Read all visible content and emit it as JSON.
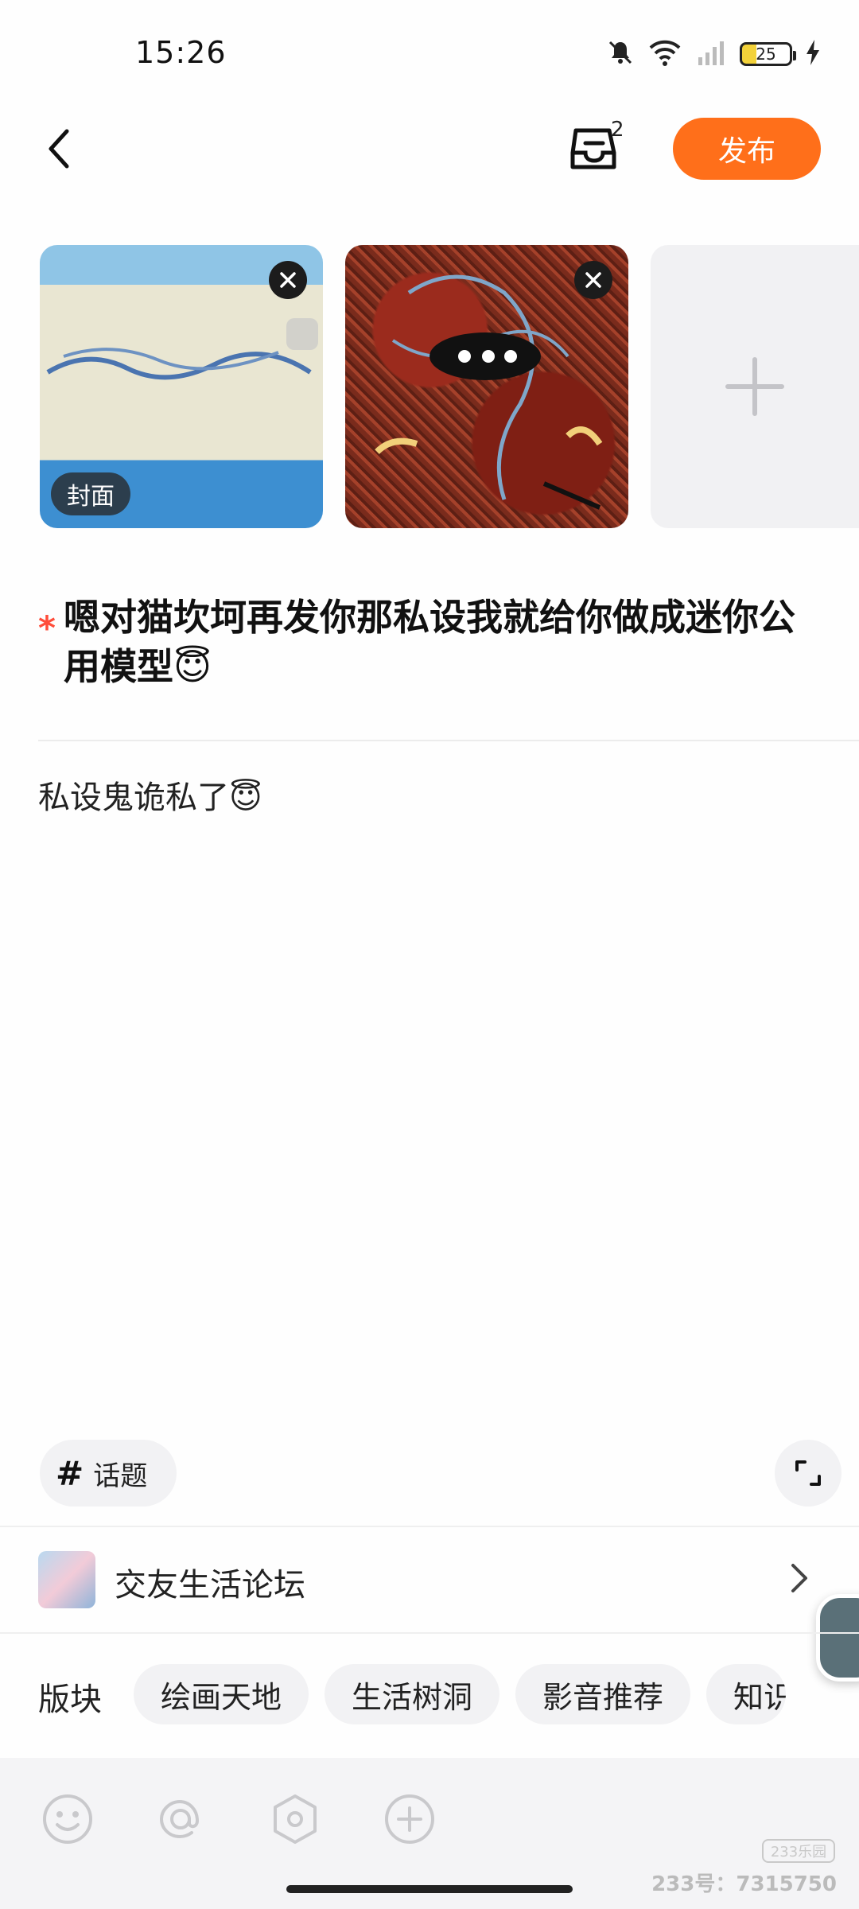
{
  "status_bar": {
    "time": "15:26",
    "battery": "25"
  },
  "header": {
    "draft_count": "2",
    "publish_label": "发布"
  },
  "images": {
    "cover_label": "封面"
  },
  "post": {
    "required_mark": "*",
    "title": "嗯对猫坎坷再发你那私设我就给你做成迷你公用模型😇",
    "body": "私设鬼诡私了😇"
  },
  "topic": {
    "hash": "#",
    "label": "话题"
  },
  "forum": {
    "name": "交友生活论坛"
  },
  "sections": {
    "label": "版块",
    "chips": [
      "绘画天地",
      "生活树洞",
      "影音推荐",
      "知识"
    ]
  },
  "watermark": {
    "logo": "233乐园",
    "text": "233号：7315750"
  },
  "colors": {
    "accent": "#ff6f1a",
    "required": "#ff4d3a"
  }
}
